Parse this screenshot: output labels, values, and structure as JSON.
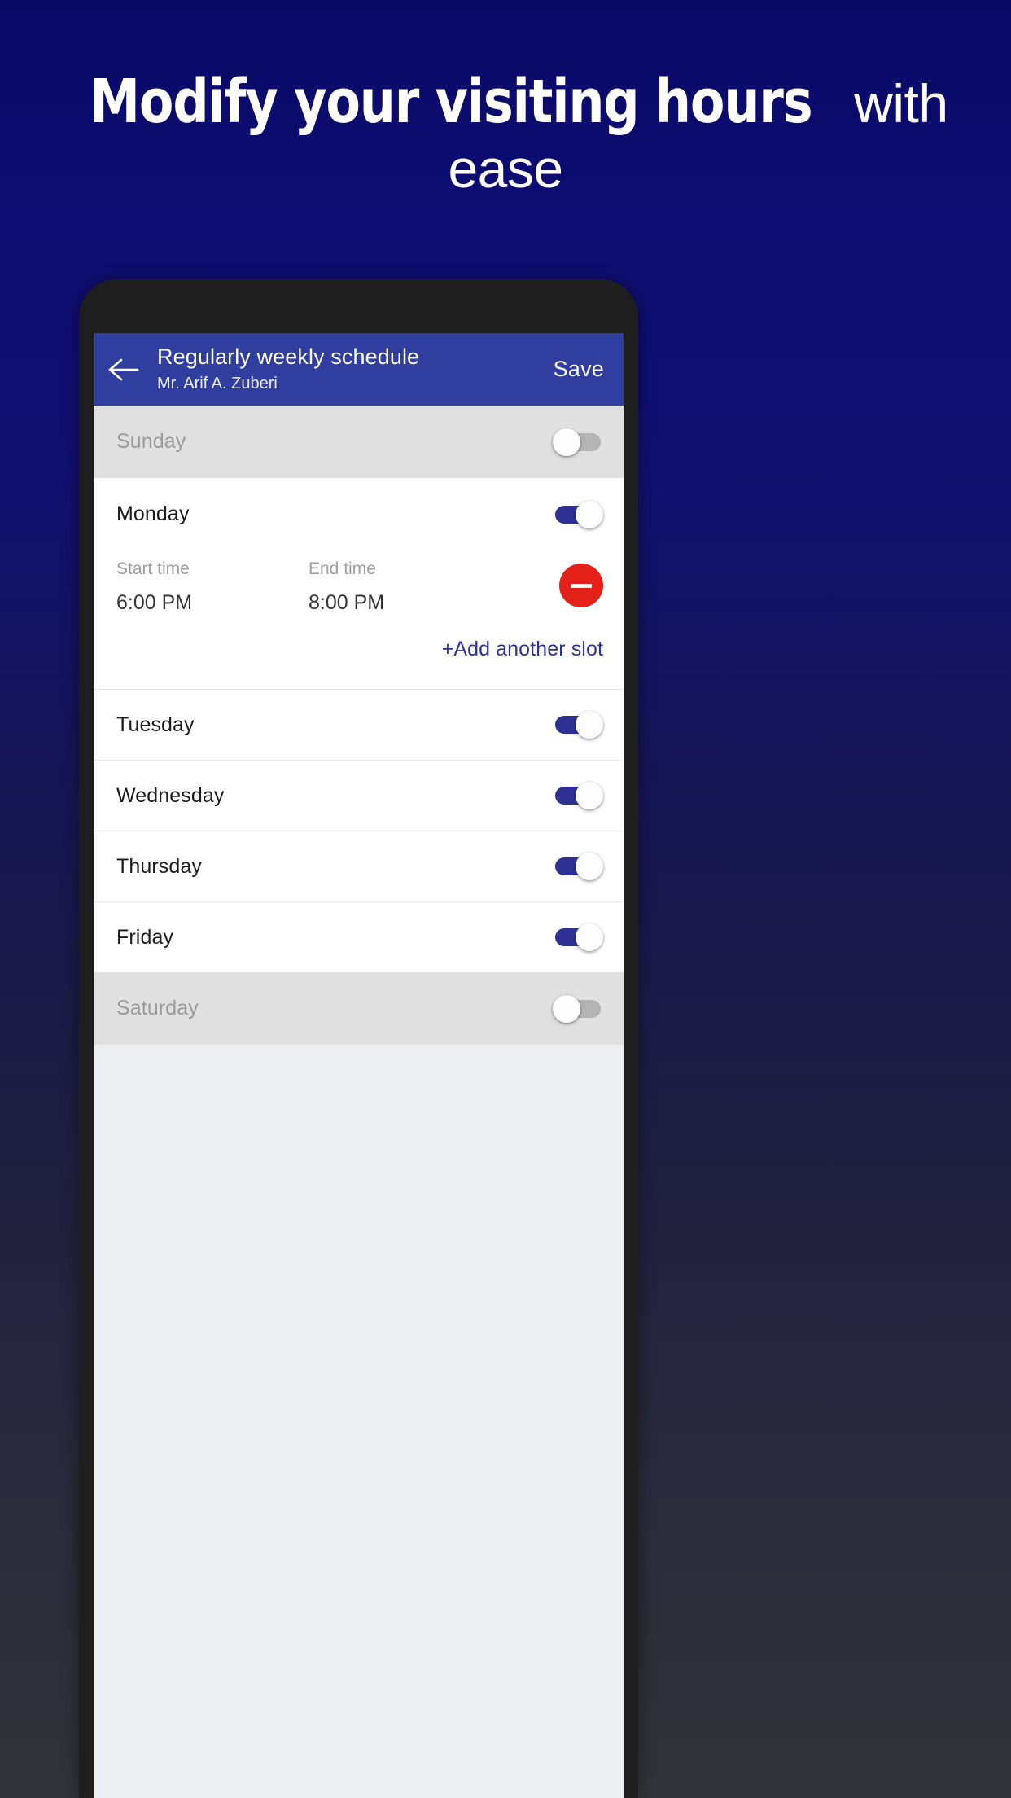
{
  "promo": {
    "headline_strong": "Modify your visiting hours",
    "headline_light": " with ease",
    "background_top_color": "#0a0a66",
    "background_bottom_color": "#33333a"
  },
  "appbar": {
    "back_icon": "arrow-left-icon",
    "title": "Regularly weekly schedule",
    "subtitle": "Mr. Arif A. Zuberi",
    "save_label": "Save",
    "background_color": "#303f9f"
  },
  "slot": {
    "start_label": "Start time",
    "start_value": "6:00 PM",
    "end_label": "End time",
    "end_value": "8:00 PM",
    "remove_icon": "minus-circle-icon",
    "remove_color": "#e32119",
    "add_label": "+Add another slot",
    "add_color": "#2f3192"
  },
  "days": [
    {
      "name": "Sunday",
      "enabled": false
    },
    {
      "name": "Monday",
      "enabled": true
    },
    {
      "name": "Tuesday",
      "enabled": true
    },
    {
      "name": "Wednesday",
      "enabled": true
    },
    {
      "name": "Thursday",
      "enabled": true
    },
    {
      "name": "Friday",
      "enabled": true
    },
    {
      "name": "Saturday",
      "enabled": false
    }
  ]
}
